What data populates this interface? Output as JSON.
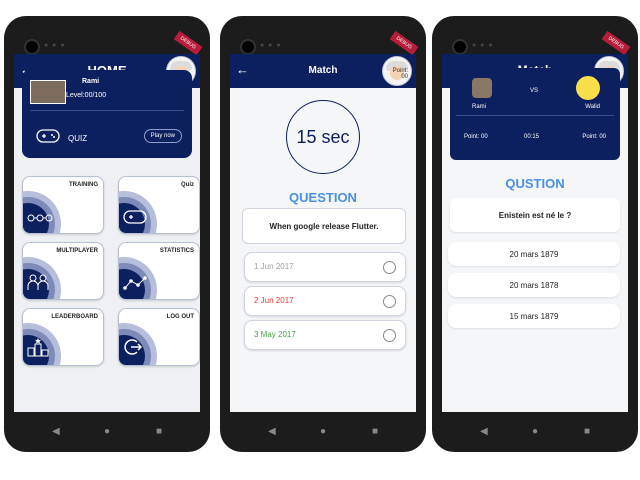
{
  "phone_home": {
    "title": "HOME",
    "back_icon": "arrow-left-icon",
    "badge": "DEBUG",
    "profile": {
      "name": "Rami",
      "level": "Level:00/100"
    },
    "quiz": {
      "label": "QUIZ",
      "button": "Play now"
    },
    "tiles": [
      {
        "label": "TRAINING",
        "icon": "training-icon"
      },
      {
        "label": "Quiz",
        "icon": "gamepad-icon"
      },
      {
        "label": "MULTIPLAYER",
        "icon": "people-icon"
      },
      {
        "label": "STATISTICS",
        "icon": "chart-icon"
      },
      {
        "label": "LEADERBOARD",
        "icon": "podium-icon"
      },
      {
        "label": "LOG OUT",
        "icon": "logout-icon"
      }
    ]
  },
  "phone_match1": {
    "title": "Match",
    "badge": "DEBUG",
    "point_label": "Point:",
    "point_value": "00",
    "timer": "15 sec",
    "question_heading": "QUESTION",
    "question": "When google release Flutter.",
    "options": [
      {
        "text": "1 Jun 2017",
        "color": "#9e9e9e"
      },
      {
        "text": "2 Jun 2017",
        "color": "#e53935"
      },
      {
        "text": "3 May 2017",
        "color": "#43a047"
      }
    ]
  },
  "phone_match2": {
    "title": "Match",
    "badge": "DEBUG",
    "player1": "Rami",
    "vs": "VS",
    "player2": "Walid",
    "point1": "Point: 00",
    "time": "00:15",
    "point2": "Point: 00",
    "question_heading": "QUSTION",
    "question": "Enistein est né le ?",
    "options": [
      "20 mars 1879",
      "20 mars 1878",
      "15 mars 1879"
    ]
  },
  "nav": {
    "back": "◀",
    "home": "●",
    "recent": "■"
  },
  "colors": {
    "primary": "#0c1f5e",
    "accent": "#4a90e2"
  }
}
